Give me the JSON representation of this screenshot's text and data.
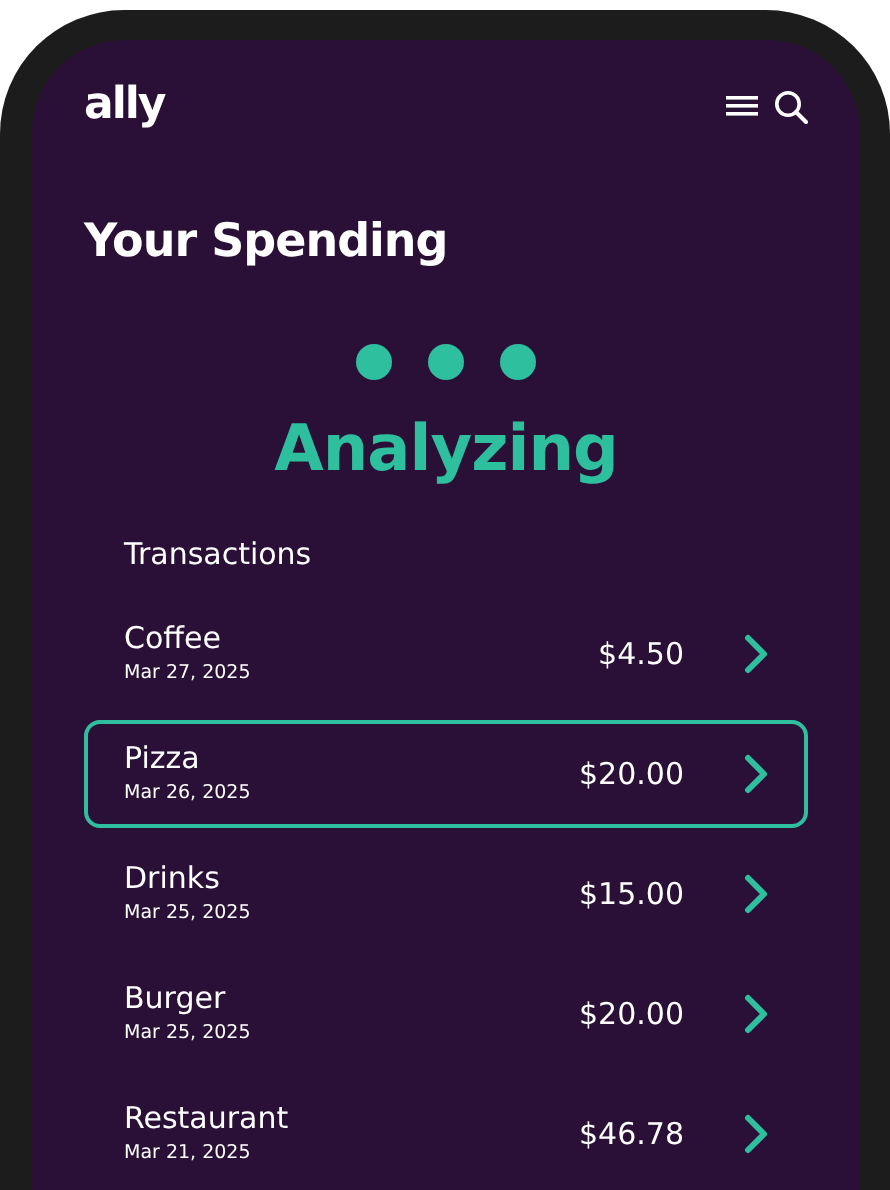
{
  "header": {
    "logo": "ally"
  },
  "title": "Your Spending",
  "status": "Analyzing",
  "section_title": "Transactions",
  "transactions": [
    {
      "name": "Coffee",
      "date": "Mar 27, 2025",
      "amount": "$4.50",
      "selected": false
    },
    {
      "name": "Pizza",
      "date": "Mar 26, 2025",
      "amount": "$20.00",
      "selected": true
    },
    {
      "name": "Drinks",
      "date": "Mar 25, 2025",
      "amount": "$15.00",
      "selected": false
    },
    {
      "name": "Burger",
      "date": "Mar 25, 2025",
      "amount": "$20.00",
      "selected": false
    },
    {
      "name": "Restaurant",
      "date": "Mar 21, 2025",
      "amount": "$46.78",
      "selected": false
    }
  ]
}
